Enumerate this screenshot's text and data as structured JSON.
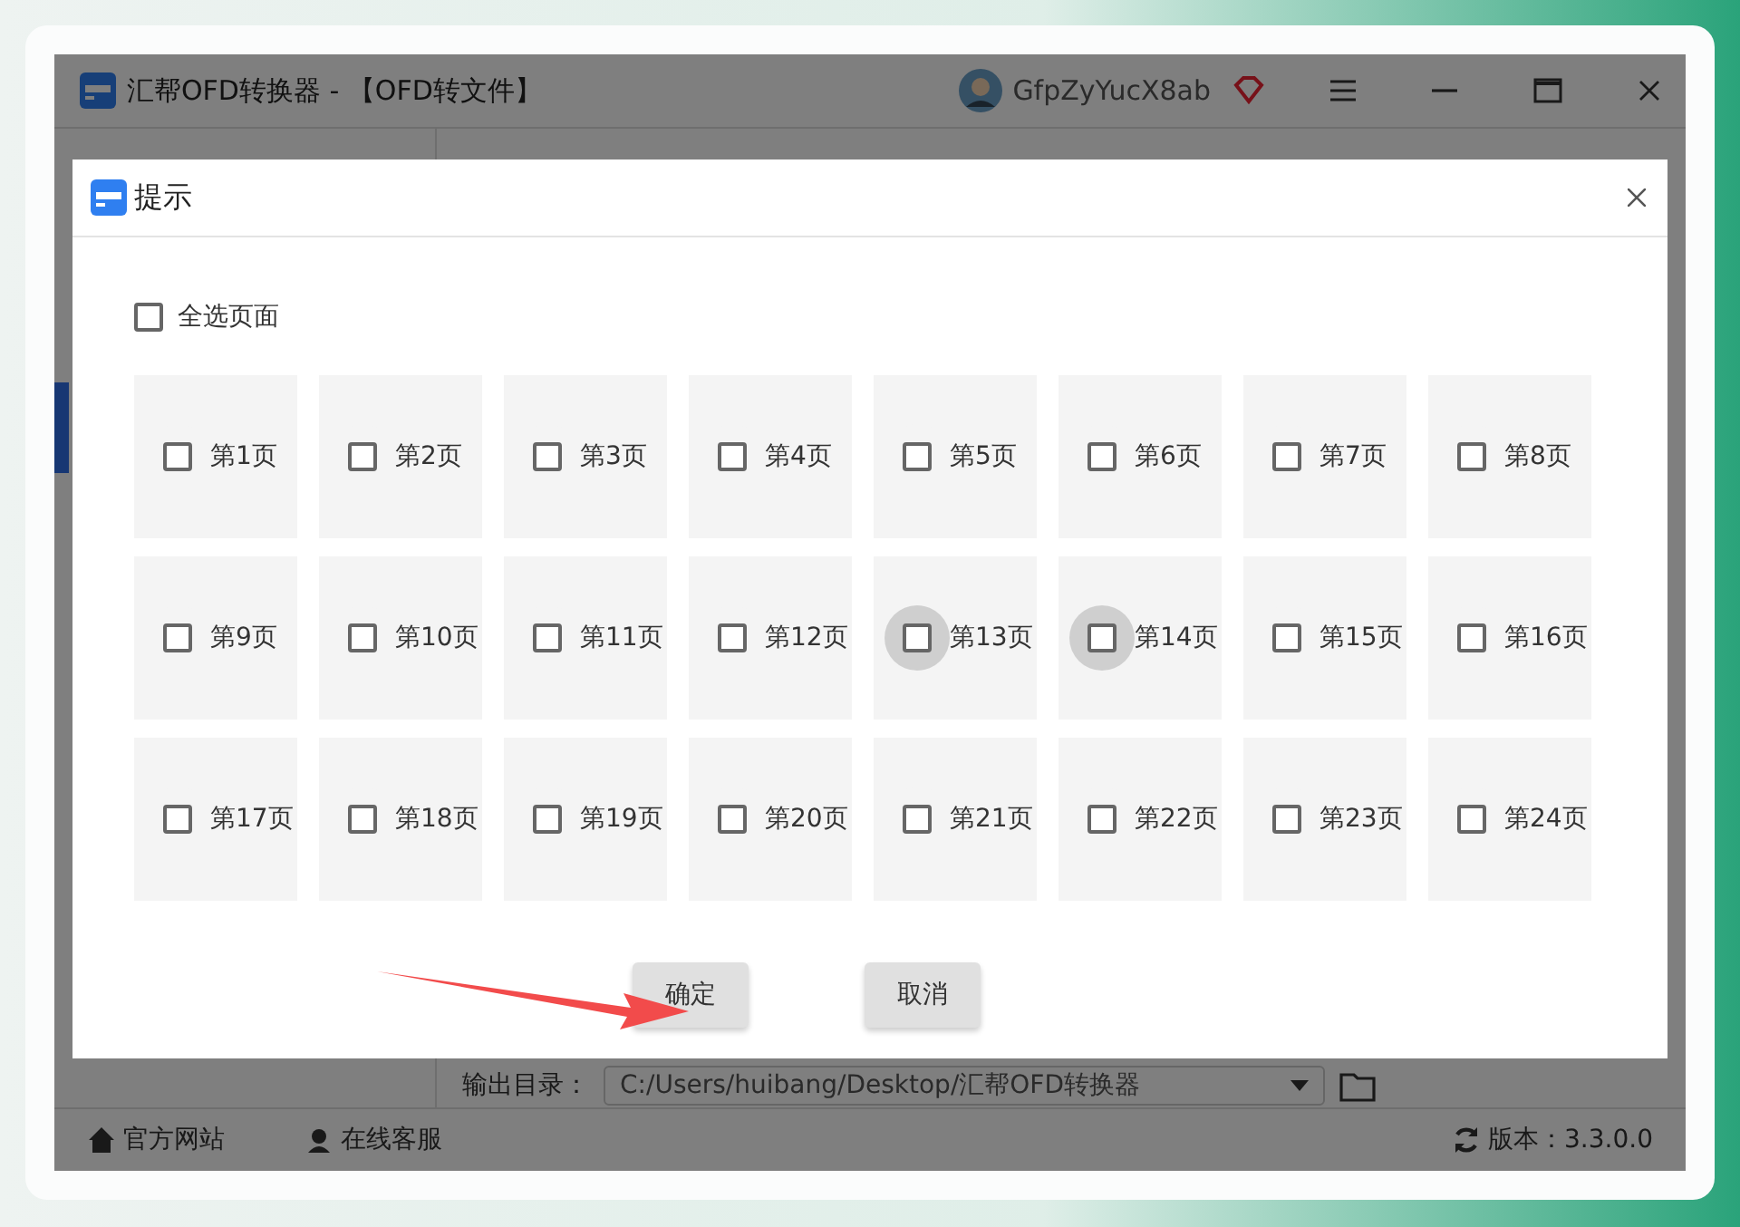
{
  "window": {
    "title": "汇帮OFD转换器 - 【OFD转文件】",
    "user": "GfpZyYucX8ab"
  },
  "output": {
    "label": "输出目录：",
    "path": "C:/Users/huibang/Desktop/汇帮OFD转换器"
  },
  "footer": {
    "links": [
      "官方网站",
      "在线客服"
    ],
    "version": "版本：3.3.0.0"
  },
  "dialog": {
    "title": "提示",
    "select_all": {
      "label": "全选页面",
      "checked": false
    },
    "pages": [
      {
        "label": "第1页",
        "checked": false,
        "hovered": false
      },
      {
        "label": "第2页",
        "checked": false,
        "hovered": false
      },
      {
        "label": "第3页",
        "checked": false,
        "hovered": false
      },
      {
        "label": "第4页",
        "checked": false,
        "hovered": false
      },
      {
        "label": "第5页",
        "checked": false,
        "hovered": false
      },
      {
        "label": "第6页",
        "checked": false,
        "hovered": false
      },
      {
        "label": "第7页",
        "checked": false,
        "hovered": false
      },
      {
        "label": "第8页",
        "checked": false,
        "hovered": false
      },
      {
        "label": "第9页",
        "checked": false,
        "hovered": false
      },
      {
        "label": "第10页",
        "checked": false,
        "hovered": false
      },
      {
        "label": "第11页",
        "checked": false,
        "hovered": false
      },
      {
        "label": "第12页",
        "checked": false,
        "hovered": false
      },
      {
        "label": "第13页",
        "checked": false,
        "hovered": true
      },
      {
        "label": "第14页",
        "checked": false,
        "hovered": true
      },
      {
        "label": "第15页",
        "checked": false,
        "hovered": false
      },
      {
        "label": "第16页",
        "checked": false,
        "hovered": false
      },
      {
        "label": "第17页",
        "checked": false,
        "hovered": false
      },
      {
        "label": "第18页",
        "checked": false,
        "hovered": false
      },
      {
        "label": "第19页",
        "checked": false,
        "hovered": false
      },
      {
        "label": "第20页",
        "checked": false,
        "hovered": false
      },
      {
        "label": "第21页",
        "checked": false,
        "hovered": false
      },
      {
        "label": "第22页",
        "checked": false,
        "hovered": false
      },
      {
        "label": "第23页",
        "checked": false,
        "hovered": false
      },
      {
        "label": "第24页",
        "checked": false,
        "hovered": false
      }
    ],
    "buttons": [
      "确定",
      "取消"
    ]
  }
}
